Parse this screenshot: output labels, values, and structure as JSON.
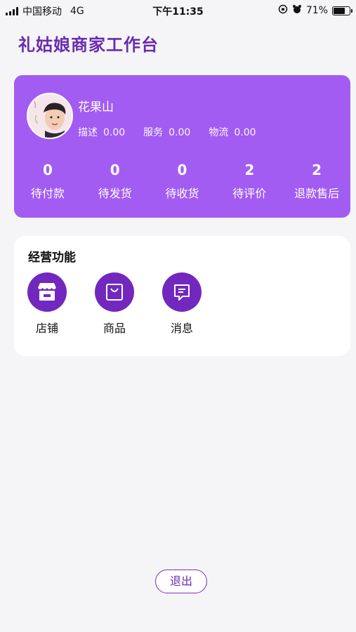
{
  "status_bar": {
    "carrier": "中国移动",
    "network": "4G",
    "time": "下午11:35",
    "battery": "71%"
  },
  "page": {
    "title": "礼姑娘商家工作台"
  },
  "profile": {
    "shop_name": "花果山",
    "ratings": [
      {
        "label": "描述",
        "value": "0.00"
      },
      {
        "label": "服务",
        "value": "0.00"
      },
      {
        "label": "物流",
        "value": "0.00"
      }
    ]
  },
  "orders": [
    {
      "count": "0",
      "label": "待付款"
    },
    {
      "count": "0",
      "label": "待发货"
    },
    {
      "count": "0",
      "label": "待收货"
    },
    {
      "count": "2",
      "label": "待评价"
    },
    {
      "count": "2",
      "label": "退款售后"
    }
  ],
  "functions": {
    "title": "经营功能",
    "items": [
      {
        "label": "店铺",
        "icon": "store-icon"
      },
      {
        "label": "商品",
        "icon": "bag-icon"
      },
      {
        "label": "消息",
        "icon": "message-icon"
      }
    ]
  },
  "logout_label": "退出",
  "colors": {
    "title": "#6a2bb0",
    "card": "#a25cf2",
    "icon_bg": "#7228be",
    "background": "#f5f5f7"
  }
}
